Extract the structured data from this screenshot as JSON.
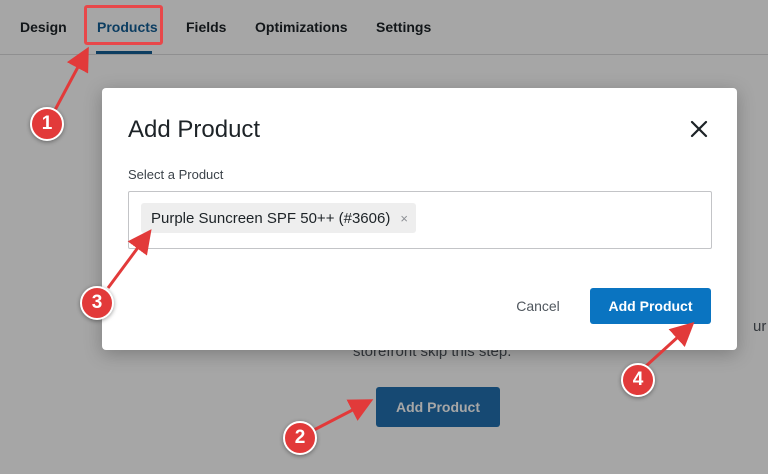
{
  "tabs": [
    {
      "label": "Design"
    },
    {
      "label": "Products"
    },
    {
      "label": "Fields"
    },
    {
      "label": "Optimizations"
    },
    {
      "label": "Settings"
    }
  ],
  "background": {
    "text_fragment_right": "ur",
    "text_fragment_line": "storefront skip this step.",
    "add_product_button": "Add Product"
  },
  "modal": {
    "title": "Add Product",
    "field_label": "Select a Product",
    "selected_product": "Purple Suncreen SPF 50++ (#3606)",
    "remove_glyph": "×",
    "close_glyph": "close-icon",
    "cancel_label": "Cancel",
    "add_label": "Add Product"
  },
  "annotations": {
    "color": "#e23a3a",
    "badges": [
      "1",
      "2",
      "3",
      "4"
    ]
  }
}
